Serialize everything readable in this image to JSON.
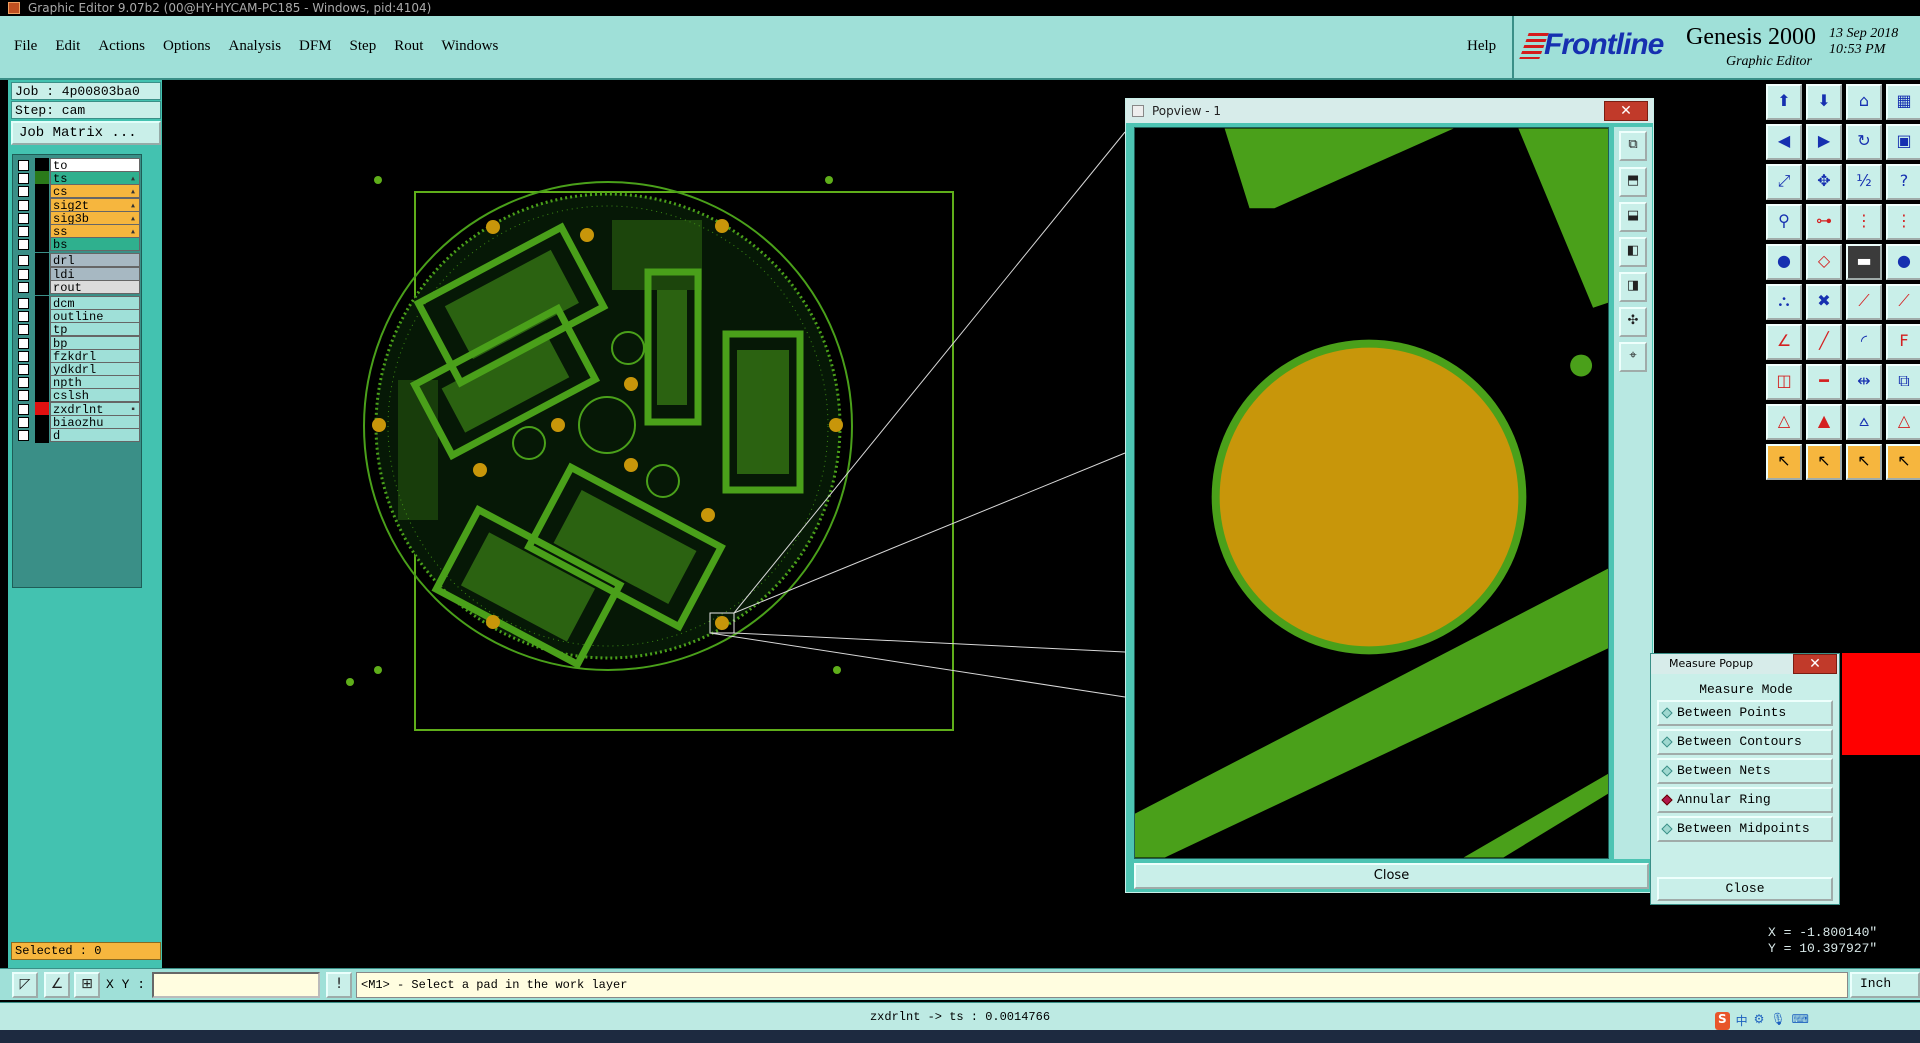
{
  "window_title": "Graphic Editor 9.07b2 (00@HY-HYCAM-PC185 - Windows, pid:4104)",
  "menu": [
    {
      "label": "File"
    },
    {
      "label": "Edit"
    },
    {
      "label": "Actions"
    },
    {
      "label": "Options"
    },
    {
      "label": "Analysis"
    },
    {
      "label": "DFM"
    },
    {
      "label": "Step"
    },
    {
      "label": "Rout"
    },
    {
      "label": "Windows"
    }
  ],
  "help_label": "Help",
  "brand": {
    "logo": "Frontline",
    "product": "Genesis 2000",
    "subtitle": "Graphic Editor",
    "date": "13 Sep 2018",
    "time": "10:53 PM"
  },
  "job": "Job : 4p00803ba0",
  "step": "Step: cam",
  "job_matrix": "Job Matrix ...",
  "layers": [
    {
      "name": "to",
      "bg": "#ffffff",
      "swatch": "#000000"
    },
    {
      "name": "ts",
      "bg": "#2fb08e",
      "swatch": "#2a7a1a",
      "mark": "▴"
    },
    {
      "name": "cs",
      "bg": "#f6b63e",
      "swatch": "#000000",
      "mark": "▴"
    },
    {
      "name": "sig2t",
      "bg": "#f6b63e",
      "swatch": "#000000",
      "mark": "▴"
    },
    {
      "name": "sig3b",
      "bg": "#f6b63e",
      "swatch": "#000000",
      "mark": "▴"
    },
    {
      "name": "ss",
      "bg": "#f6b63e",
      "swatch": "#000000",
      "mark": "▴"
    },
    {
      "name": "bs",
      "bg": "#2fb08e",
      "swatch": "#000000"
    },
    {
      "name": "drl",
      "bg": "#a7b8c2",
      "swatch": "#000000"
    },
    {
      "name": "ldi",
      "bg": "#a7b8c2",
      "swatch": "#000000"
    },
    {
      "name": "rout",
      "bg": "#dcdcdc",
      "swatch": "#000000"
    },
    {
      "name": "dcm",
      "bg": "#9fe0d8",
      "swatch": "#000000"
    },
    {
      "name": "outline",
      "bg": "#9fe0d8",
      "swatch": "#000000"
    },
    {
      "name": "tp",
      "bg": "#9fe0d8",
      "swatch": "#000000"
    },
    {
      "name": "bp",
      "bg": "#9fe0d8",
      "swatch": "#000000"
    },
    {
      "name": "fzkdrl",
      "bg": "#9fe0d8",
      "swatch": "#000000"
    },
    {
      "name": "ydkdrl",
      "bg": "#9fe0d8",
      "swatch": "#000000"
    },
    {
      "name": "npth",
      "bg": "#9fe0d8",
      "swatch": "#000000"
    },
    {
      "name": "cslsh",
      "bg": "#9fe0d8",
      "swatch": "#000000"
    },
    {
      "name": "zxdrlnt",
      "bg": "#9fe0d8",
      "swatch": "#e01010",
      "mark": "▪"
    },
    {
      "name": "biaozhu",
      "bg": "#9fe0d8",
      "swatch": "#000000"
    },
    {
      "name": "d",
      "bg": "#9fe0d8",
      "swatch": "#000000"
    }
  ],
  "selected": "Selected : 0",
  "xy_label": "X Y :",
  "xy_value": "",
  "prompt": "<M1> - Select a pad in the work layer",
  "units": "Inch",
  "status_line": "zxdrlnt -> ts : 0.0014766",
  "popview": {
    "title": "Popview - 1",
    "close_label": "Close"
  },
  "measure": {
    "title": "Measure Popup",
    "header": "Measure Mode",
    "modes": [
      {
        "label": "Between Points",
        "selected": false
      },
      {
        "label": "Between Contours",
        "selected": false
      },
      {
        "label": "Between Nets",
        "selected": false
      },
      {
        "label": "Annular Ring",
        "selected": true
      },
      {
        "label": "Between Midpoints",
        "selected": false
      }
    ],
    "close_label": "Close"
  },
  "coords": {
    "x": "X = -1.800140\"",
    "y": "Y = 10.397927\""
  },
  "tray_logo": "S",
  "tray_ime": "中",
  "colors": {
    "copper": "#4aa01a",
    "pad": "#c8960a",
    "panel": "#9fe0d8",
    "accent": "#43c2b0"
  }
}
